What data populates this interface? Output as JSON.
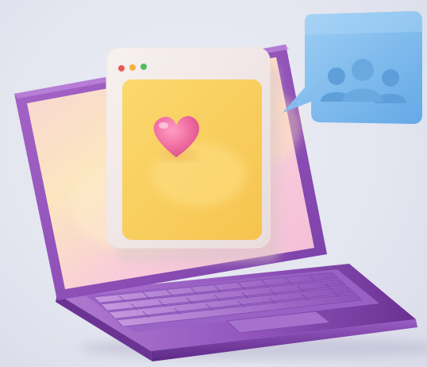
{
  "scene": {
    "subject": "3d-laptop-with-heart-card-and-group-chat-bubble",
    "icons": [
      "laptop-icon",
      "browser-window-icon",
      "heart-icon",
      "chat-bubble-icon",
      "people-group-icon"
    ],
    "colors": {
      "background": "#e5e7f0",
      "laptop_body": "#8b4fb8",
      "laptop_body_dark": "#5e2c88",
      "screen_pink": "#f7c6d6",
      "screen_yellow": "#f8e3a6",
      "card_yellow": "#f9d160",
      "card_frame": "#f3ecea",
      "heart": "#f06ba0",
      "bubble_blue": "#7ab8ec",
      "window_dot_red": "#e9574f",
      "window_dot_yellow": "#f2b23a",
      "window_dot_green": "#4fbf63"
    }
  }
}
